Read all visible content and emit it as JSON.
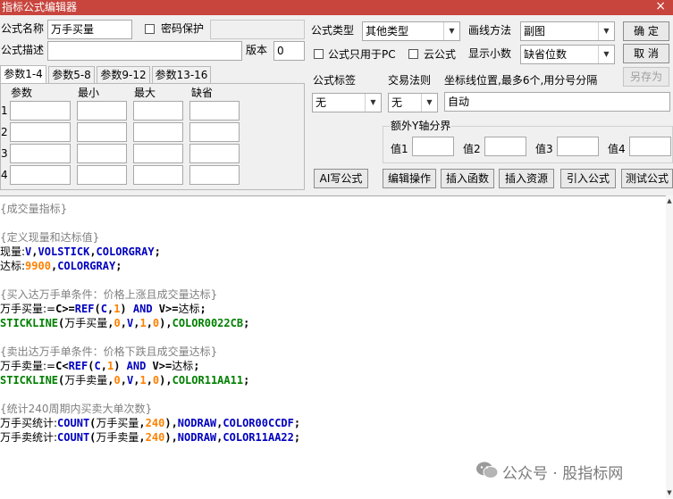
{
  "window": {
    "title": "指标公式编辑器",
    "close": "×"
  },
  "form": {
    "name_label": "公式名称",
    "name_value": "万手买量",
    "pwd_label": "密码保护",
    "desc_label": "公式描述",
    "desc_value": "",
    "version_label": "版本",
    "version_value": "0",
    "type_label": "公式类型",
    "type_value": "其他类型",
    "only_pc_label": "公式只用于PC",
    "cloud_label": "云公式",
    "draw_label": "画线方法",
    "draw_value": "副图",
    "decimals_label": "显示小数",
    "decimals_value": "缺省位数",
    "ok": "确  定",
    "cancel": "取  消",
    "save_as": "另存为",
    "tag_label": "公式标签",
    "tag_value": "无",
    "rule_label": "交易法则",
    "rule_value": "无",
    "coord_label": "坐标线位置,最多6个,用分号分隔",
    "coord_value": "自动",
    "extra_y_label": "额外Y轴分界",
    "y_vals": [
      "值1",
      "值2",
      "值3",
      "值4"
    ]
  },
  "tabs": [
    "参数1-4",
    "参数5-8",
    "参数9-12",
    "参数13-16"
  ],
  "params": {
    "headers": [
      "参数",
      "最小",
      "最大",
      "缺省"
    ],
    "rows": [
      "1",
      "2",
      "3",
      "4"
    ]
  },
  "buttons": {
    "ai": "AI写公式",
    "edit": "编辑操作",
    "insert_fn": "插入函数",
    "insert_res": "插入资源",
    "import": "引入公式",
    "test": "测试公式"
  },
  "code": {
    "c1": "{成交量指标}",
    "c2": "{定义现量和达标值}",
    "l1_id": "现量:",
    "l1_v": "V",
    "l1_c": ",",
    "l1_kw": "VOLSTICK",
    "l1_c2": ",",
    "l1_fn": "COLORGRAY",
    "l1_end": ";",
    "l2_id": "达标:",
    "l2_num": "9900",
    "l2_c": ",",
    "l2_fn": "COLORGRAY",
    "l2_end": ";",
    "c3": "{买入达万手单条件：价格上涨且成交量达标}",
    "l3_id": "万手买量:=",
    "l3_a": "C>=",
    "l3_fn": "REF",
    "l3_b": "(",
    "l3_c": "C",
    "l3_d": ",",
    "l3_n": "1",
    "l3_e": ") ",
    "l3_and": "AND",
    "l3_f": " V>=",
    "l3_id2": "达标",
    "l3_end": ";",
    "l4_kw": "STICKLINE",
    "l4_a": "(",
    "l4_id": "万手买量",
    "l4_b": ",",
    "l4_n1": "0",
    "l4_c": ",",
    "l4_v": "V",
    "l4_d": ",",
    "l4_n2": "1",
    "l4_e": ",",
    "l4_n3": "0",
    "l4_f": "),",
    "l4_col": "COLOR0022CB",
    "l4_end": ";",
    "c4": "{卖出达万手单条件：价格下跌且成交量达标}",
    "l5_id": "万手卖量:=",
    "l5_a": "C<",
    "l5_fn": "REF",
    "l5_b": "(",
    "l5_c": "C",
    "l5_d": ",",
    "l5_n": "1",
    "l5_e": ") ",
    "l5_and": "AND",
    "l5_f": " V>=",
    "l5_id2": "达标",
    "l5_end": ";",
    "l6_kw": "STICKLINE",
    "l6_a": "(",
    "l6_id": "万手卖量",
    "l6_b": ",",
    "l6_n1": "0",
    "l6_c": ",",
    "l6_v": "V",
    "l6_d": ",",
    "l6_n2": "1",
    "l6_e": ",",
    "l6_n3": "0",
    "l6_f": "),",
    "l6_col": "COLOR11AA11",
    "l6_end": ";",
    "c5": "{统计240周期内买卖大单次数}",
    "l7_id": "万手买统计:",
    "l7_fn": "COUNT",
    "l7_a": "(",
    "l7_id2": "万手买量",
    "l7_b": ",",
    "l7_n": "240",
    "l7_c": "),",
    "l7_kw": "NODRAW",
    "l7_d": ",",
    "l7_col": "COLOR00CCDF",
    "l7_end": ";",
    "l8_id": "万手卖统计:",
    "l8_fn": "COUNT",
    "l8_a": "(",
    "l8_id2": "万手卖量",
    "l8_b": ",",
    "l8_n": "240",
    "l8_c": "),",
    "l8_kw": "NODRAW",
    "l8_d": ",",
    "l8_col": "COLOR11AA22",
    "l8_end": ";"
  },
  "watermark": {
    "text": "公众号 · 股指标网",
    "icon": "wechat-icon"
  }
}
